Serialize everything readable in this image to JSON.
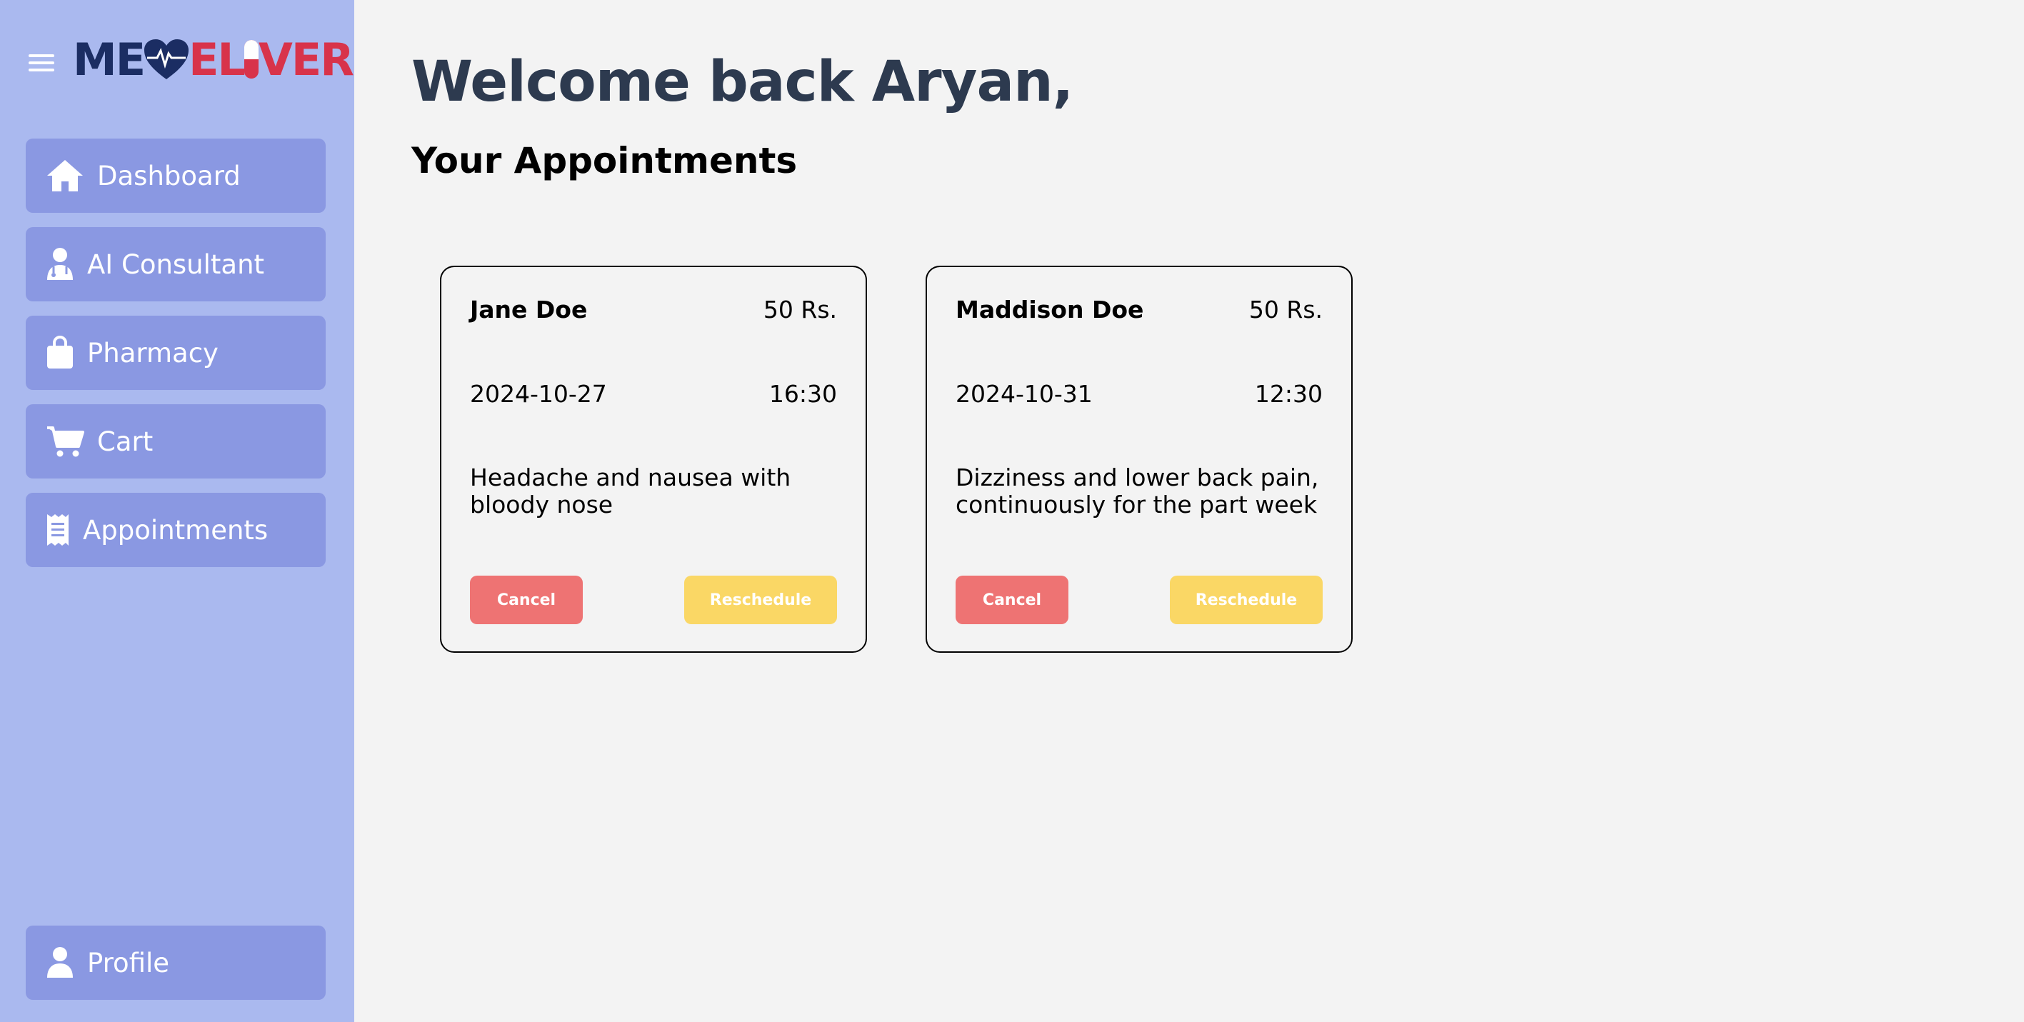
{
  "logo": {
    "part1": "ME",
    "part2": "EL",
    "part3": "VER"
  },
  "sidebar": {
    "items": [
      {
        "label": "Dashboard",
        "icon": "home-icon"
      },
      {
        "label": "AI Consultant",
        "icon": "doctor-icon"
      },
      {
        "label": "Pharmacy",
        "icon": "shopping-bag-icon"
      },
      {
        "label": "Cart",
        "icon": "cart-icon"
      },
      {
        "label": "Appointments",
        "icon": "receipt-icon"
      }
    ],
    "profile": {
      "label": "Profile",
      "icon": "user-icon"
    }
  },
  "main": {
    "title": "Welcome back Aryan,",
    "subtitle": "Your Appointments"
  },
  "appointments": [
    {
      "name": "Jane Doe",
      "price": "50 Rs.",
      "date": "2024-10-27",
      "time": "16:30",
      "description": "Headache and nausea with bloody nose",
      "cancel": "Cancel",
      "reschedule": "Reschedule"
    },
    {
      "name": "Maddison Doe",
      "price": "50 Rs.",
      "date": "2024-10-31",
      "time": "12:30",
      "description": "Dizziness and lower back pain, continuously for the part week",
      "cancel": "Cancel",
      "reschedule": "Reschedule"
    }
  ],
  "colors": {
    "sidebar_bg": "#aab9ef",
    "nav_button": "#8a98e2",
    "cancel": "#ee7373",
    "reschedule": "#fad765",
    "title": "#2d3a4f",
    "logo_dark": "#1b2d63",
    "logo_red": "#d8334a"
  }
}
